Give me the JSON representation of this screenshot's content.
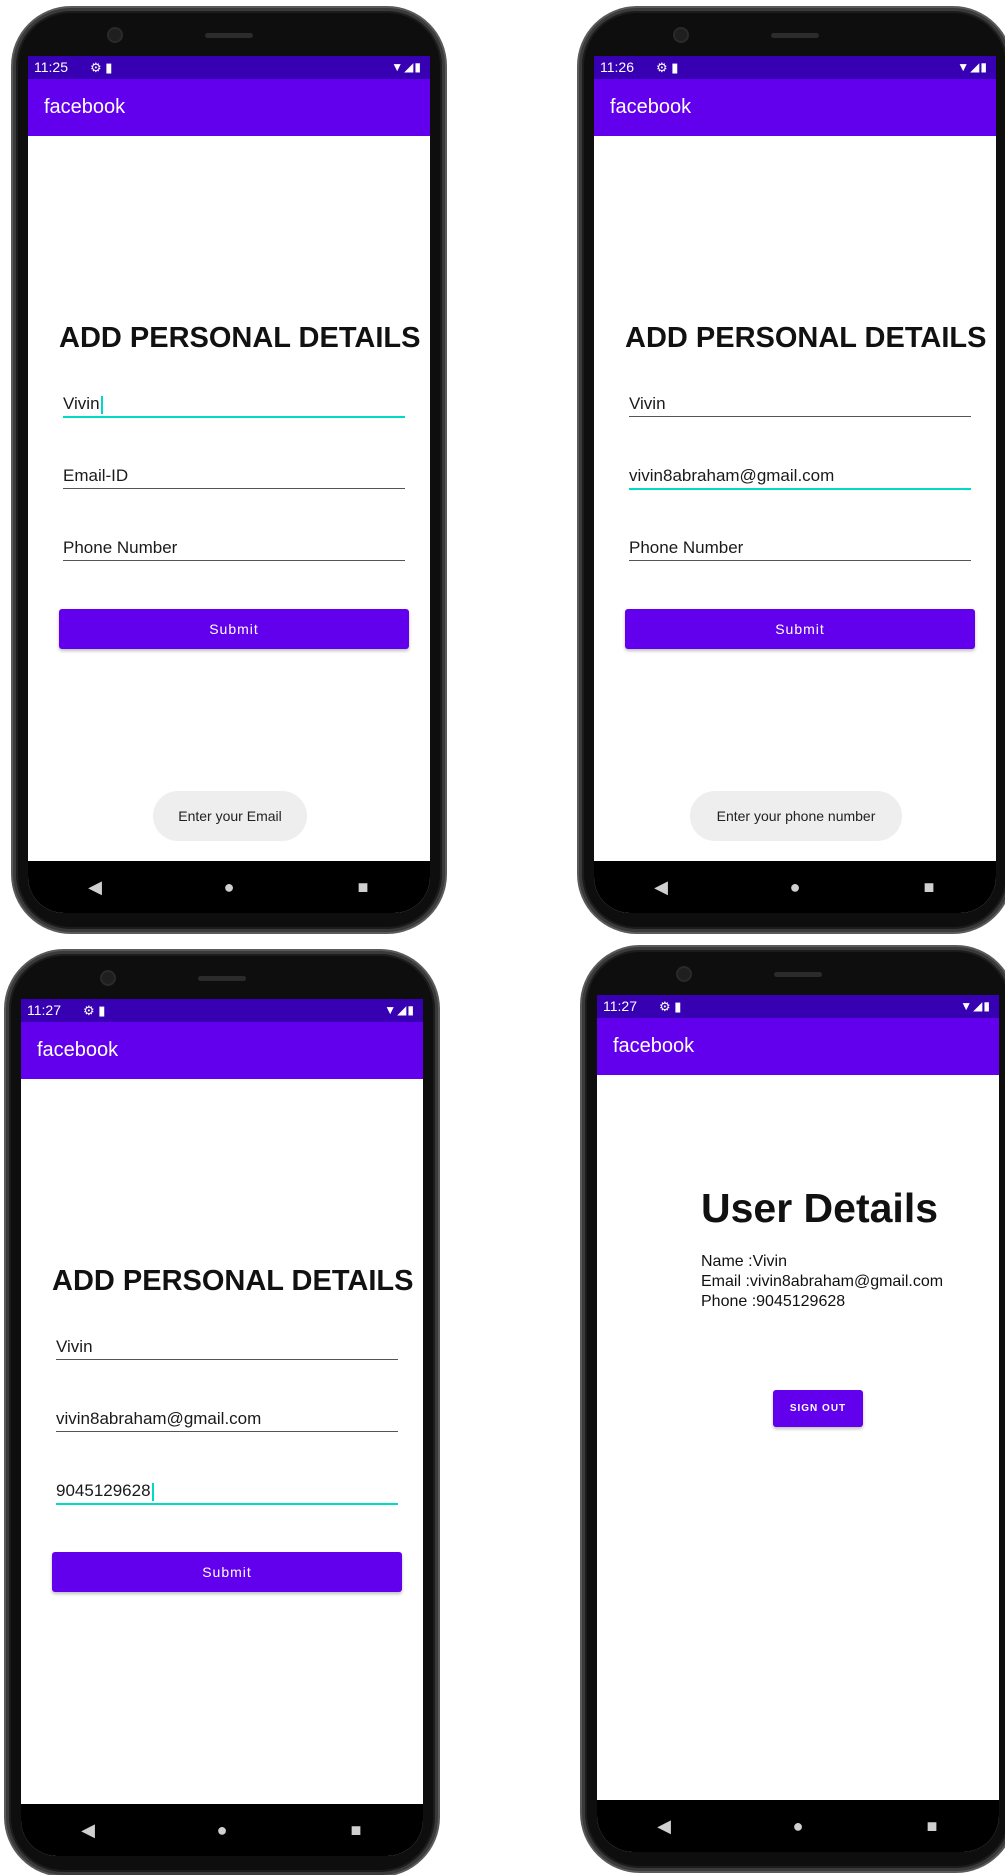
{
  "screens": [
    {
      "status_time": "11:25",
      "app_title": "facebook",
      "heading": "ADD PERSONAL DETAILS",
      "name_value": "Vivin",
      "email_placeholder": "Email-ID",
      "phone_placeholder": "Phone Number",
      "submit_label": "Submit",
      "toast": "Enter your Email"
    },
    {
      "status_time": "11:26",
      "app_title": "facebook",
      "heading": "ADD PERSONAL DETAILS",
      "name_value": "Vivin",
      "email_value": "vivin8abraham@gmail.com",
      "phone_placeholder": "Phone Number",
      "submit_label": "Submit",
      "toast": "Enter your phone number"
    },
    {
      "status_time": "11:27",
      "app_title": "facebook",
      "heading": "ADD PERSONAL DETAILS",
      "name_value": "Vivin",
      "email_value": "vivin8abraham@gmail.com",
      "phone_value": "9045129628",
      "submit_label": "Submit"
    },
    {
      "status_time": "11:27",
      "app_title": "facebook",
      "heading": "User Details",
      "name_line": "Name :Vivin",
      "email_line": "Email :vivin8abraham@gmail.com",
      "phone_line": "Phone :9045129628",
      "signout_label": "SIGN OUT"
    }
  ],
  "colors": {
    "appbar": "#6200ee",
    "statusbar": "#3700b3",
    "accent": "#03dac5"
  },
  "icons": {
    "status": [
      "settings-icon",
      "sd-card-icon",
      "wifi-icon",
      "signal-icon",
      "battery-icon"
    ],
    "nav": [
      "back-icon",
      "home-icon",
      "recents-icon"
    ]
  }
}
